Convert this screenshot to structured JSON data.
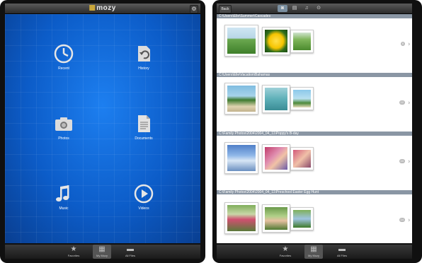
{
  "left": {
    "app_name": "mozy",
    "menu": [
      {
        "id": "recent",
        "label": "Recent",
        "icon": "clock-icon"
      },
      {
        "id": "history",
        "label": "History",
        "icon": "restore-icon"
      },
      {
        "id": "photos",
        "label": "Photos",
        "icon": "camera-icon"
      },
      {
        "id": "documents",
        "label": "Documents",
        "icon": "document-icon"
      },
      {
        "id": "music",
        "label": "Music",
        "icon": "music-note-icon"
      },
      {
        "id": "videos",
        "label": "Videos",
        "icon": "play-icon"
      }
    ],
    "tabs": [
      {
        "label": "Favorites",
        "icon": "star-icon"
      },
      {
        "label": "My Mozy",
        "icon": "grid-icon",
        "active": true
      },
      {
        "label": "All Files",
        "icon": "folder-icon"
      }
    ]
  },
  "right": {
    "back_label": "Back",
    "segments": [
      "camera-icon",
      "document-icon",
      "music-note-icon",
      "play-icon"
    ],
    "sections": [
      {
        "path": "C:\\Users\\Elle\\Summer\\Cascades",
        "count": "8"
      },
      {
        "path": "C:\\Users\\Elle\\Vacation\\Bahamas",
        "count": "12"
      },
      {
        "path": "C:\\Family Photos\\2004\\2004_04_11\\Poppy's B-day",
        "count": "10"
      },
      {
        "path": "C:\\Family Photos\\2004\\2004_04_11\\Preschool Easter Egg Hunt",
        "count": "14"
      }
    ],
    "tabs": [
      {
        "label": "Favorites",
        "icon": "star-icon"
      },
      {
        "label": "My Mozy",
        "icon": "grid-icon",
        "active": true
      },
      {
        "label": "All Files",
        "icon": "folder-icon"
      }
    ]
  },
  "colors": {
    "accent_blue": "#0c5cc8",
    "section_header": "#8a96a4"
  }
}
